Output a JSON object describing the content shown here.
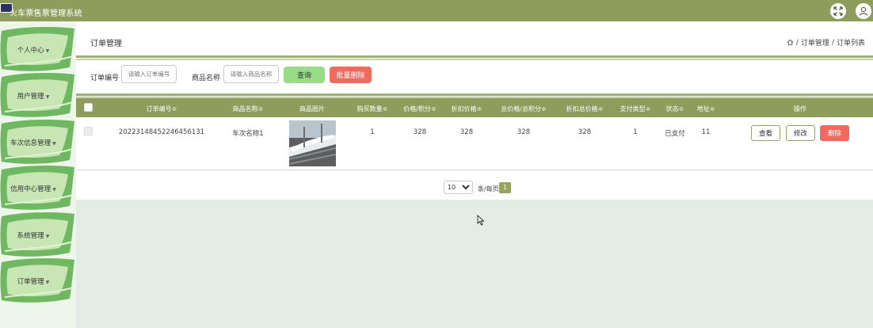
{
  "app": {
    "title": "火车票售票管理系统"
  },
  "sidebar": {
    "items": [
      {
        "label": "个人中心"
      },
      {
        "label": "用户管理"
      },
      {
        "label": "车次信息管理"
      },
      {
        "label": "信用中心管理"
      },
      {
        "label": "系统管理"
      },
      {
        "label": "订单管理"
      }
    ]
  },
  "page": {
    "title": "订单管理",
    "breadcrumb": [
      "订单管理",
      "订单列表"
    ],
    "breadcrumb_sep": "/"
  },
  "search": {
    "order_no_label": "订单编号",
    "order_no_placeholder": "请输入订单编号",
    "goods_name_label": "商品名称",
    "goods_name_placeholder": "请输入商品名称",
    "query_button": "查询",
    "batch_delete_button": "批量删除"
  },
  "table": {
    "headers": {
      "order_no": "订单编号≑",
      "goods_name": "商品名称≑",
      "goods_image": "商品图片",
      "quantity": "购买数量≑",
      "price_points": "价格/积分≑",
      "discount_price": "折扣价格≑",
      "total_price_points": "总价格/总积分≑",
      "discount_total": "折扣总价格≑",
      "payment_type": "支付类型≑",
      "status": "状态≑",
      "address": "地址≑",
      "operations": "操作"
    },
    "rows": [
      {
        "order_no": "20223148452246456131",
        "goods_name": "车次名称1",
        "quantity": "1",
        "price_points": "328",
        "discount_price": "328",
        "total_price_points": "328",
        "discount_total": "328",
        "payment_type": "1",
        "status": "已支付",
        "address": "11",
        "view_button": "查看",
        "edit_button": "修改",
        "delete_button": "删除"
      }
    ]
  },
  "pagination": {
    "page_size": "10",
    "page_size_options": [
      "10"
    ],
    "per_page_label": "条/每页",
    "current_page": "1"
  },
  "colors": {
    "topbar": "#8e9d5c",
    "table_header": "#8e9d5c",
    "query_button": "#98dc8a",
    "danger_button": "#ef6b5e",
    "sidebar_blob": "#6fb861"
  },
  "icons": {
    "fullscreen": "fullscreen-icon",
    "user": "user-icon",
    "home": "home-icon"
  }
}
